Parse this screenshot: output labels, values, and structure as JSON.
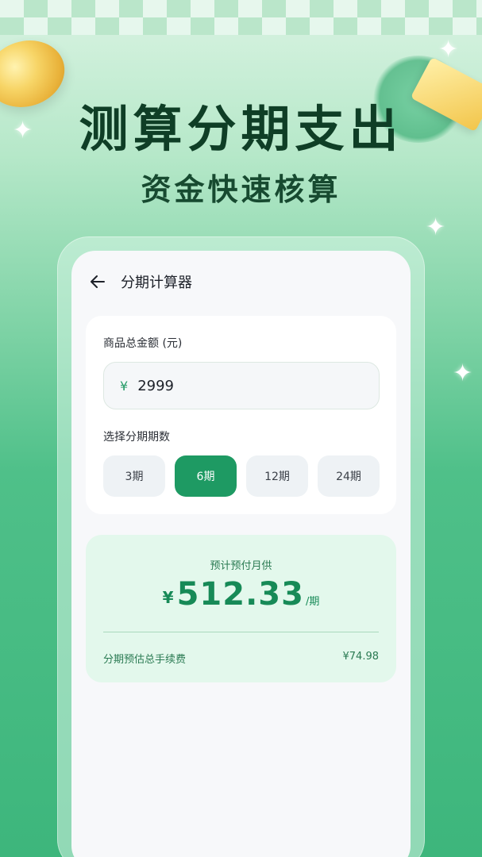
{
  "promo": {
    "headline": "测算分期支出",
    "subline": "资金快速核算"
  },
  "app": {
    "title": "分期计算器",
    "back_icon": "arrow-left-icon"
  },
  "form": {
    "amount_label": "商品总金额 (元)",
    "currency_symbol": "¥",
    "amount_value": "2999",
    "period_label": "选择分期期数",
    "periods": [
      "3期",
      "6期",
      "12期",
      "24期"
    ],
    "selected_period": "6期"
  },
  "result": {
    "estimate_label": "预计预付月供",
    "currency_symbol": "¥",
    "monthly_amount": "512.33",
    "unit": "/期",
    "fee_label": "分期预估总手续费",
    "fee_value": "¥74.98"
  },
  "colors": {
    "accent": "#1e9a63",
    "headline": "#0f3e26",
    "result_bg": "#e3f8ec"
  }
}
